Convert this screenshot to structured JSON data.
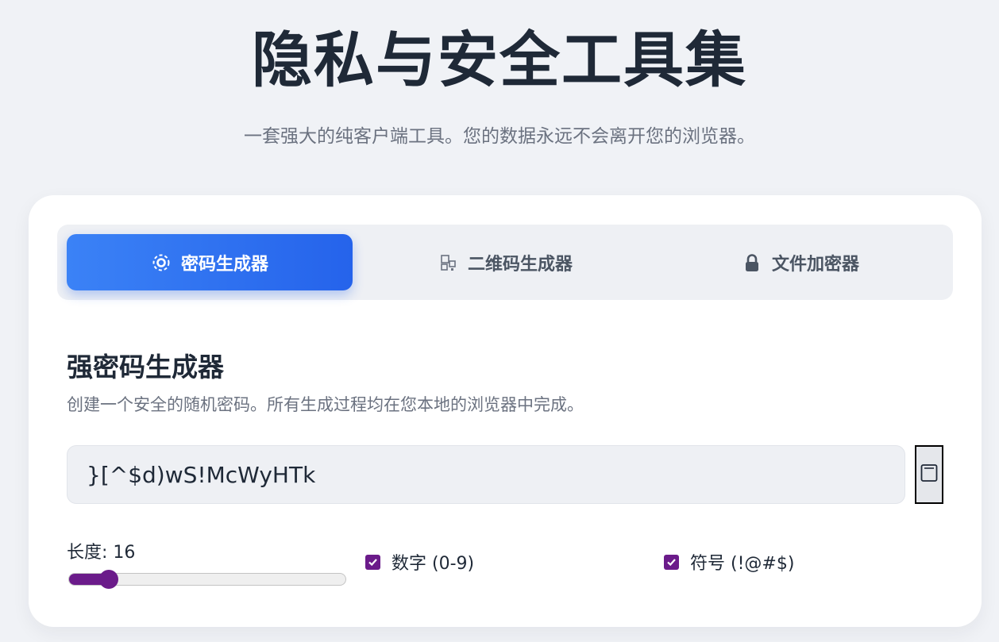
{
  "header": {
    "title": "隐私与安全工具集",
    "subtitle": "一套强大的纯客户端工具。您的数据永远不会离开您的浏览器。"
  },
  "tabs": [
    {
      "label": "密码生成器",
      "icon": "gear-icon",
      "active": true
    },
    {
      "label": "二维码生成器",
      "icon": "qr-code-icon",
      "active": false
    },
    {
      "label": "文件加密器",
      "icon": "lock-icon",
      "active": false
    }
  ],
  "password_generator": {
    "title": "强密码生成器",
    "description": "创建一个安全的随机密码。所有生成过程均在您本地的浏览器中完成。",
    "password": "}[^$d)wS!McWyHTk",
    "copy_icon": "copy-icon",
    "length_label": "长度: 16",
    "length_value": 16,
    "length_min": 8,
    "length_max": 64,
    "options": [
      {
        "label": "数字 (0-9)",
        "checked": true
      },
      {
        "label": "符号 (!@#$)",
        "checked": true
      }
    ]
  },
  "colors": {
    "accent": "#2563eb",
    "accent_light": "#3b82f6",
    "check": "#6b1b8a",
    "background": "#f0f2f6"
  }
}
